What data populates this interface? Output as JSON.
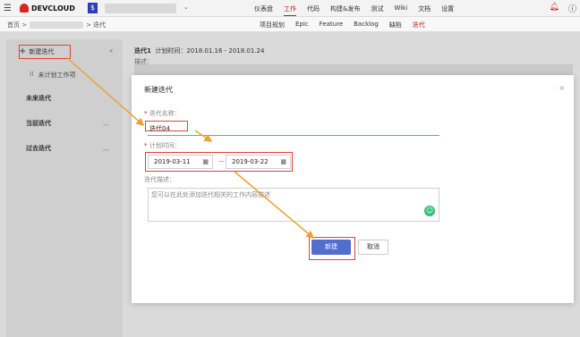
{
  "topbar": {
    "brand": "DEVCLOUD",
    "project_icon": "$",
    "nav": [
      "仪表盘",
      "工作",
      "代码",
      "构建&发布",
      "测试",
      "Wiki",
      "文档",
      "设置"
    ],
    "active_nav": "工作"
  },
  "breadcrumb": {
    "home": "首页 >",
    "current": "> 迭代"
  },
  "subnav": [
    "项目规划",
    "Epic",
    "Feature",
    "Backlog",
    "缺陷",
    "迭代"
  ],
  "subnav_active": "迭代",
  "sidebar": {
    "new_label": "新建迭代",
    "plan_label": "未计划工作项",
    "future": "未来迭代",
    "current": "当前迭代",
    "past": "过去迭代"
  },
  "content": {
    "sprint_name": "迭代1",
    "plan_time": "计划时间：2018.01.16 - 2018.01.24",
    "desc_label": "描述："
  },
  "modal": {
    "title": "新建迭代",
    "name_label": "迭代名称：",
    "name_value": "迭代04",
    "time_label": "计划时间：",
    "start_date": "2019-03-11",
    "end_date": "2019-03-22",
    "date_separator": "—",
    "desc_label": "迭代描述：",
    "desc_placeholder": "您可以在此处添加迭代相关的工作内容描述",
    "ok_label": "新建",
    "cancel_label": "取消",
    "close_label": "×"
  },
  "colors": {
    "accent_red": "#c9171e",
    "primary_blue": "#526ecc",
    "highlight": "#e0413b",
    "arrow": "#f0a030"
  }
}
